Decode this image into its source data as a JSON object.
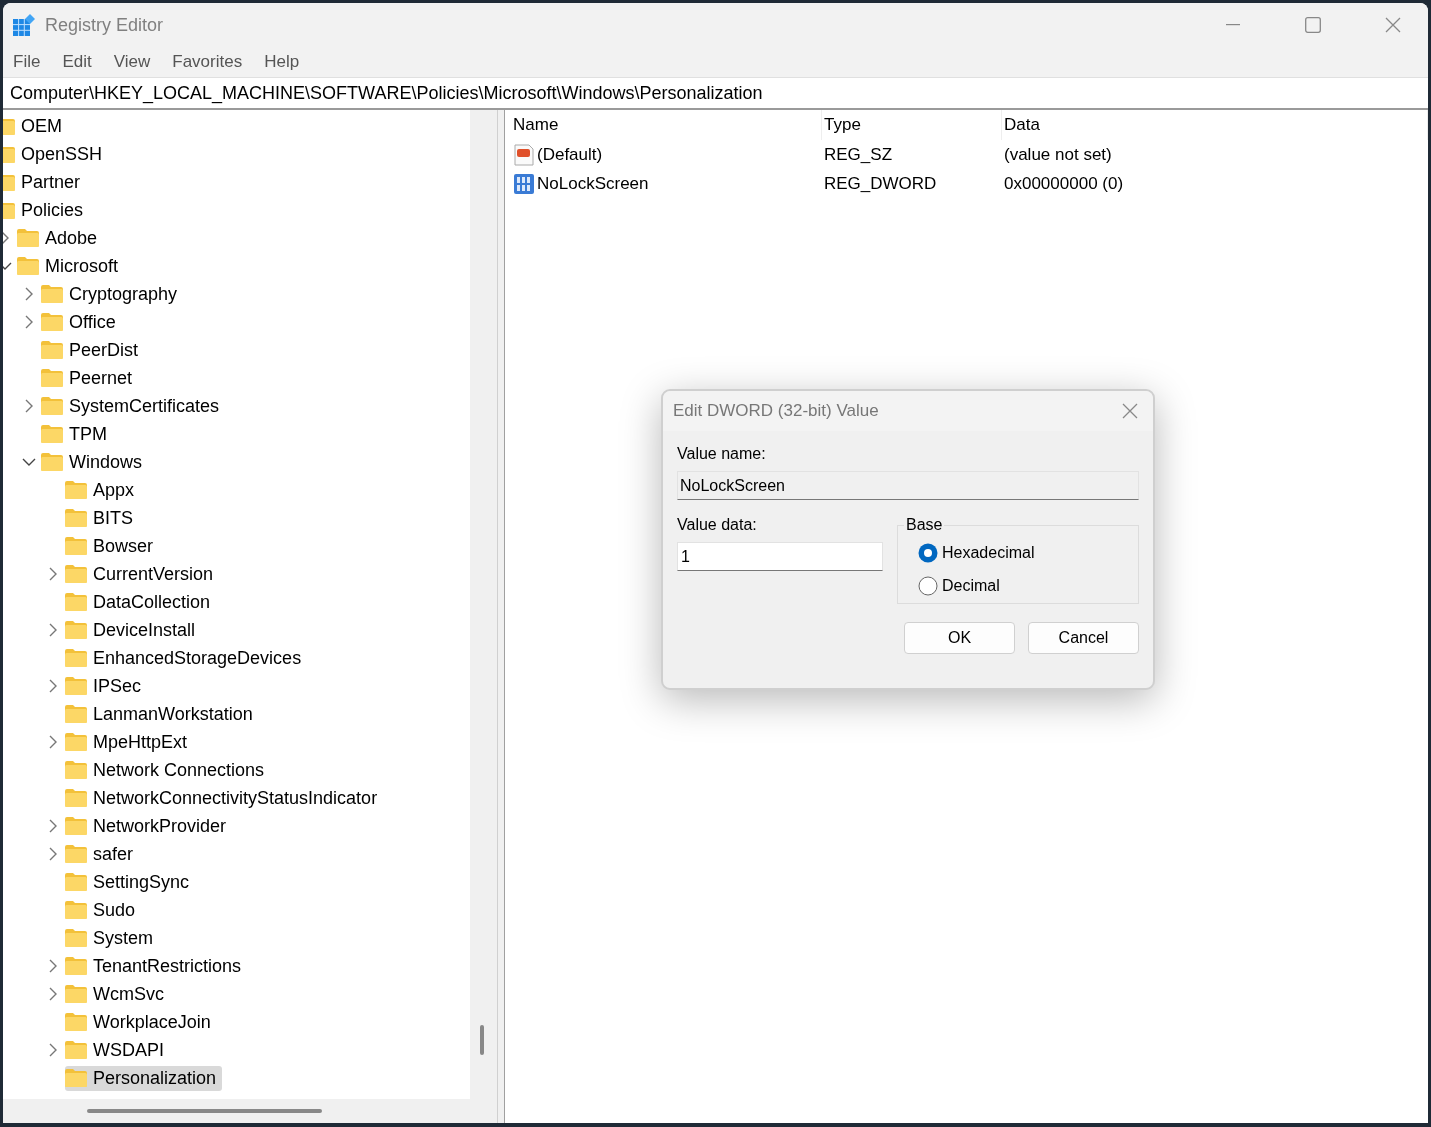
{
  "window": {
    "title": "Registry Editor"
  },
  "menu": [
    {
      "label": "File"
    },
    {
      "label": "Edit"
    },
    {
      "label": "View"
    },
    {
      "label": "Favorites"
    },
    {
      "label": "Help"
    }
  ],
  "address": "Computer\\HKEY_LOCAL_MACHINE\\SOFTWARE\\Policies\\Microsoft\\Windows\\Personalization",
  "tree": [
    {
      "label": "OEM",
      "selected": false
    },
    {
      "label": "OpenSSH",
      "selected": false
    },
    {
      "label": "Partner",
      "selected": false
    },
    {
      "label": "Policies",
      "selected": false,
      "children": [
        {
          "label": "Adobe",
          "kind": "collapsed",
          "selected": false
        },
        {
          "label": "Microsoft",
          "kind": "expanded",
          "selected": false,
          "children": [
            {
              "label": "Cryptography",
              "kind": "collapsed",
              "selected": false
            },
            {
              "label": "Office",
              "kind": "collapsed",
              "selected": false
            },
            {
              "label": "PeerDist",
              "kind": "leaf",
              "selected": false
            },
            {
              "label": "Peernet",
              "kind": "leaf",
              "selected": false
            },
            {
              "label": "SystemCertificates",
              "kind": "collapsed",
              "selected": false
            },
            {
              "label": "TPM",
              "kind": "leaf",
              "selected": false
            },
            {
              "label": "Windows",
              "kind": "expanded",
              "selected": false,
              "children": [
                {
                  "label": "Appx",
                  "kind": "leaf",
                  "selected": false
                },
                {
                  "label": "BITS",
                  "kind": "leaf",
                  "selected": false
                },
                {
                  "label": "Bowser",
                  "kind": "leaf",
                  "selected": false
                },
                {
                  "label": "CurrentVersion",
                  "kind": "collapsed",
                  "selected": false
                },
                {
                  "label": "DataCollection",
                  "kind": "leaf",
                  "selected": false
                },
                {
                  "label": "DeviceInstall",
                  "kind": "collapsed",
                  "selected": false
                },
                {
                  "label": "EnhancedStorageDevices",
                  "kind": "leaf",
                  "selected": false
                },
                {
                  "label": "IPSec",
                  "kind": "collapsed",
                  "selected": false
                },
                {
                  "label": "LanmanWorkstation",
                  "kind": "leaf",
                  "selected": false
                },
                {
                  "label": "MpeHttpExt",
                  "kind": "collapsed",
                  "selected": false
                },
                {
                  "label": "Network Connections",
                  "kind": "leaf",
                  "selected": false
                },
                {
                  "label": "NetworkConnectivityStatusIndicator",
                  "kind": "leaf",
                  "selected": false
                },
                {
                  "label": "NetworkProvider",
                  "kind": "collapsed",
                  "selected": false
                },
                {
                  "label": "safer",
                  "kind": "collapsed",
                  "selected": false
                },
                {
                  "label": "SettingSync",
                  "kind": "leaf",
                  "selected": false
                },
                {
                  "label": "Sudo",
                  "kind": "leaf",
                  "selected": false
                },
                {
                  "label": "System",
                  "kind": "leaf",
                  "selected": false
                },
                {
                  "label": "TenantRestrictions",
                  "kind": "collapsed",
                  "selected": false
                },
                {
                  "label": "WcmSvc",
                  "kind": "collapsed",
                  "selected": false
                },
                {
                  "label": "WorkplaceJoin",
                  "kind": "leaf",
                  "selected": false
                },
                {
                  "label": "WSDAPI",
                  "kind": "collapsed",
                  "selected": false
                },
                {
                  "label": "Personalization",
                  "kind": "leaf",
                  "selected": true
                }
              ]
            }
          ]
        }
      ]
    }
  ],
  "table": {
    "columns": [
      "Name",
      "Type",
      "Data"
    ],
    "rows": [
      {
        "kind": "string",
        "cells": [
          "(Default)",
          "REG_SZ",
          "(value not set)"
        ]
      },
      {
        "kind": "binary",
        "cells": [
          "NoLockScreen",
          "REG_DWORD",
          "0x00000000 (0)"
        ]
      }
    ]
  },
  "dialog": {
    "title": "Edit DWORD (32-bit) Value",
    "name_label": {
      "label": "Value name:"
    },
    "name_value": "NoLockScreen",
    "data_label": {
      "label": "Value data:"
    },
    "data_value": "1",
    "base_title": "Base",
    "base_options": [
      {
        "label": "Hexadecimal",
        "selected": true
      },
      {
        "label": "Decimal",
        "selected": false
      }
    ],
    "buttons": [
      "OK",
      "Cancel"
    ]
  }
}
